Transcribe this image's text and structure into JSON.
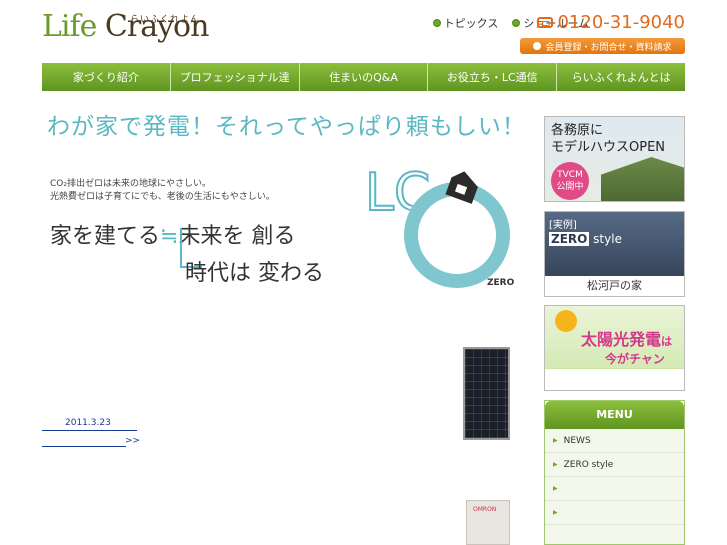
{
  "logo": {
    "text_life": "Life",
    "text_crayon": "Crayon",
    "sub": "らいふくれよん"
  },
  "topnav": {
    "items": [
      {
        "label": "トピックス"
      },
      {
        "label": "ショールーム"
      }
    ]
  },
  "tel": {
    "number": "0120-31-9040"
  },
  "member_button": {
    "label": "会員登録・お問合せ・資料請求"
  },
  "mainnav": {
    "items": [
      {
        "label": "家づくり紹介"
      },
      {
        "label": "プロフェッショナル達"
      },
      {
        "label": "住まいのQ&A"
      },
      {
        "label": "お役立ち・LC通信"
      },
      {
        "label": "らいふくれよんとは"
      }
    ]
  },
  "hero": {
    "headline": "わが家で発電！それってやっぱり頼もしい！",
    "note_line1": "CO₂排出ゼロは未来の地球にやさしい。",
    "note_line2": "光熱費ゼロは子育てにでも、老後の生活にもやさしい。",
    "slogan_a": "家を建てる",
    "slogan_eq": "≒",
    "slogan_b": "未来を 創る",
    "slogan_c": "時代は 変わる",
    "lc_text": "LC",
    "zero_text": "ZERO"
  },
  "news": {
    "date": "2011.3.23",
    "more": ">>"
  },
  "power_unit_label": "OMRON",
  "sidebar": {
    "banner1": {
      "line1": "各務原に",
      "line2": "モデルハウスOPEN",
      "tvcm": "TVCM",
      "tvcm2": "公開中"
    },
    "banner2": {
      "tag": "[実例]",
      "zero": "ZERO",
      "style": "style",
      "caption": "松河戸の家"
    },
    "banner3": {
      "line1": "太陽光発電",
      "line2": "今がチャンス!!",
      "suffix": "は"
    },
    "menu": {
      "title": "MENU",
      "items": [
        {
          "label": "NEWS"
        },
        {
          "label": "ZERO style"
        },
        {
          "label": ""
        },
        {
          "label": ""
        }
      ]
    }
  },
  "colors": {
    "accent_green": "#6aa82a",
    "headline_teal": "#5ab8c4",
    "orange": "#e37510",
    "link_blue": "#1a3a99"
  }
}
